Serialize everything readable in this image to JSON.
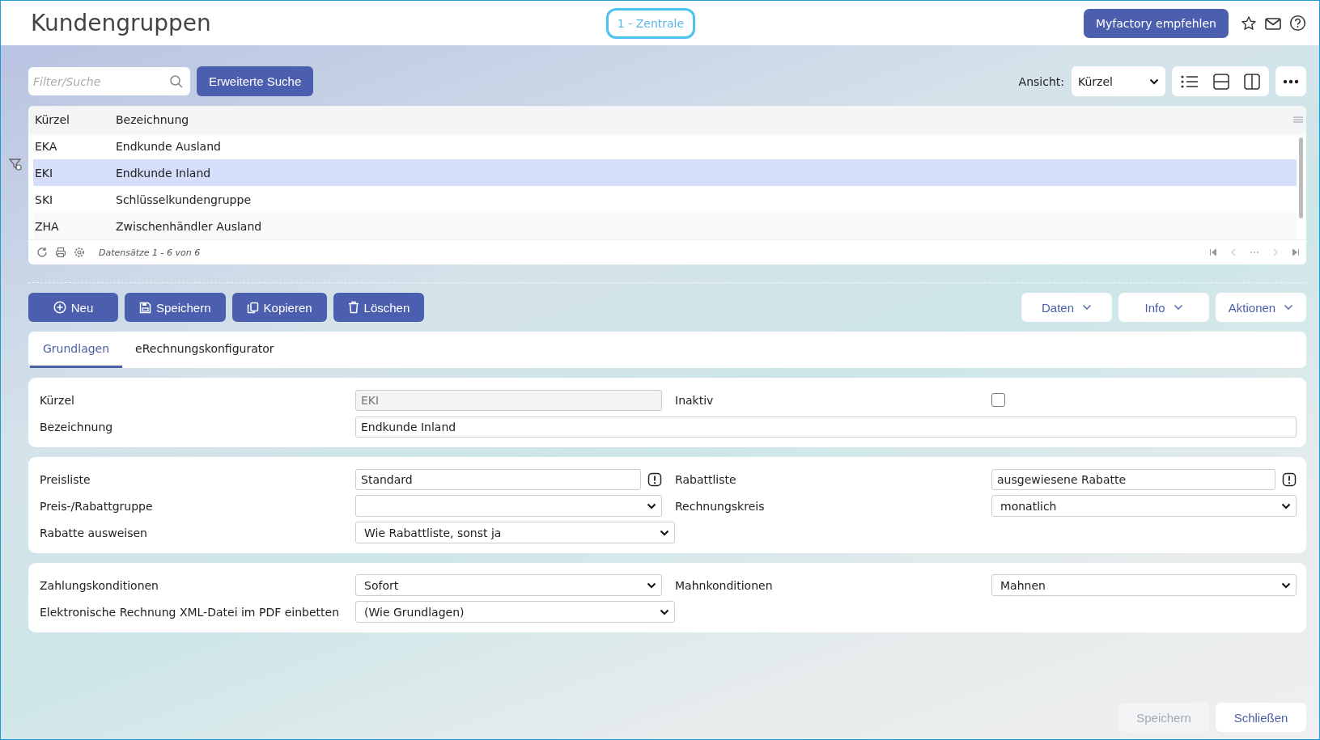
{
  "header": {
    "title": "Kundengruppen",
    "company": "1 - Zentrale",
    "recommend_button": "Myfactory empfehlen"
  },
  "search": {
    "placeholder": "Filter/Suche",
    "advanced_button": "Erweiterte Suche"
  },
  "view": {
    "label": "Ansicht:",
    "value": "Kürzel"
  },
  "table": {
    "columns": [
      "Kürzel",
      "Bezeichnung"
    ],
    "rows": [
      {
        "cells": [
          "EKA",
          "Endkunde Ausland"
        ],
        "selected": false
      },
      {
        "cells": [
          "EKI",
          "Endkunde Inland"
        ],
        "selected": true
      },
      {
        "cells": [
          "SKI",
          "Schlüsselkundengruppe"
        ],
        "selected": false
      },
      {
        "cells": [
          "ZHA",
          "Zwischenhändler Ausland"
        ],
        "selected": false
      }
    ],
    "record_count": "Datensätze 1 - 6 von 6"
  },
  "actions": [
    {
      "label": "Neu",
      "kind": "new"
    },
    {
      "label": "Speichern",
      "kind": "save"
    },
    {
      "label": "Kopieren",
      "kind": "copy"
    },
    {
      "label": "Löschen",
      "kind": "delete"
    }
  ],
  "menus": [
    "Daten",
    "Info",
    "Aktionen"
  ],
  "tabs": [
    {
      "label": "Grundlagen",
      "selected": true
    },
    {
      "label": "eRechnungskonfigurator",
      "selected": false
    }
  ],
  "cards": [
    {
      "rows": [
        [
          {
            "label": "Kürzel",
            "kind": "text",
            "value": "EKI",
            "disabled": true
          },
          {
            "label": "Inaktiv",
            "kind": "checkbox",
            "checked": false
          }
        ],
        [
          {
            "label": "Bezeichnung",
            "kind": "text",
            "value": "Endkunde Inland",
            "disabled": false,
            "wide": true
          }
        ]
      ]
    },
    {
      "rows": [
        [
          {
            "label": "Preisliste",
            "kind": "text",
            "value": "Standard",
            "disabled": false,
            "alert": true
          },
          {
            "label": "Rabattliste",
            "kind": "text",
            "value": "ausgewiesene Rabatte",
            "disabled": false,
            "alert": true
          }
        ],
        [
          {
            "label": "Preis-/Rabattgruppe",
            "kind": "select"
          },
          {
            "label": "Rechnungskreis",
            "kind": "select",
            "value": "monatlich"
          }
        ],
        [
          {
            "label": "Rabatte ausweisen",
            "kind": "select",
            "value": "Wie Rabattliste, sonst ja"
          }
        ]
      ]
    },
    {
      "rows": [
        [
          {
            "label": "Zahlungskonditionen",
            "kind": "select",
            "value": "Sofort"
          },
          {
            "label": "Mahnkonditionen",
            "kind": "select",
            "value": "Mahnen"
          }
        ],
        [
          {
            "label": "Elektronische Rechnung XML-Datei im PDF einbetten",
            "kind": "select",
            "value": "(Wie Grundlagen)"
          }
        ]
      ]
    }
  ],
  "footer_buttons": [
    {
      "label": "Speichern",
      "disabled": true
    },
    {
      "label": "Schließen",
      "disabled": false
    }
  ]
}
